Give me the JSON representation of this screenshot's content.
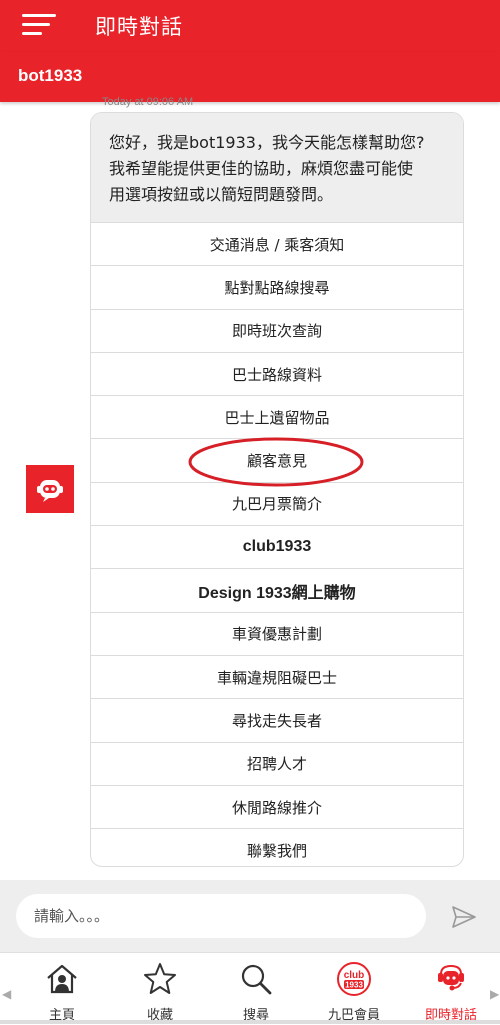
{
  "header": {
    "title": "即時對話",
    "menu_icon": "hamburger-menu-icon",
    "accent_color": "#e8232a"
  },
  "bot_bar": {
    "name": "bot1933"
  },
  "chat": {
    "timestamp": "Today at 09:06 AM",
    "avatar_icon": "robot-icon",
    "greeting_lines": [
      "您好，我是bot1933，我今天能怎樣幫助您?",
      "我希望能提供更佳的協助，麻煩您盡可能使",
      "用選項按鈕或以簡短問題發問。"
    ],
    "options": [
      "交通消息 / 乘客須知",
      "點對點路線搜尋",
      "即時班次查詢",
      "巴士路線資料",
      "巴士上遺留物品",
      "顧客意見",
      "九巴月票簡介",
      "club1933",
      "Design 1933網上購物",
      "車資優惠計劃",
      "車輛違規阻礙巴士",
      "尋找走失長者",
      "招聘人才",
      "休閒路線推介",
      "聯繫我們"
    ],
    "highlighted_option": "顧客意見"
  },
  "input": {
    "placeholder": "請輸入。。。",
    "value": "",
    "send_icon": "send-icon"
  },
  "tabs": [
    {
      "label": "主頁",
      "icon": "home-icon",
      "active": false
    },
    {
      "label": "收藏",
      "icon": "star-icon",
      "active": false
    },
    {
      "label": "搜尋",
      "icon": "search-icon",
      "active": false
    },
    {
      "label": "九巴會員",
      "icon": "club1933-icon",
      "badge_text": [
        "club",
        "1933"
      ],
      "active": false
    },
    {
      "label": "即時對話",
      "icon": "chat-robot-icon",
      "active": true
    }
  ],
  "colors": {
    "brand_red": "#e8232a",
    "bubble_gray": "#eeeeee"
  }
}
